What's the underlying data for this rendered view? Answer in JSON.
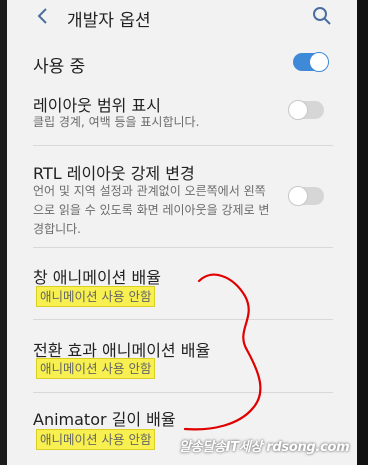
{
  "header": {
    "title": "개발자 옵션",
    "back_icon": "chevron-left-icon",
    "search_icon": "search-icon"
  },
  "main_toggle": {
    "label": "사용 중",
    "state": "on"
  },
  "items": [
    {
      "title": "레이아웃 범위 표시",
      "desc": "클립 경계, 여백 등을 표시합니다.",
      "toggle": "off"
    },
    {
      "title": "RTL 레이아웃 강제 변경",
      "desc": "언어 및 지역 설정과 관계없이 오른쪽에서 왼쪽으로 읽을 수 있도록 화면 레이아웃을 강제로 변경합니다.",
      "toggle": "off"
    },
    {
      "title": "창 애니메이션 배율",
      "value": "애니메이션 사용 안함"
    },
    {
      "title": "전환 효과 애니메이션 배율",
      "value": "애니메이션 사용 안함"
    },
    {
      "title": "Animator 길이 배율",
      "value": "애니메이션 사용 안함"
    }
  ],
  "watermark": "알송달송IT세상 rdsong.com",
  "colors": {
    "accent": "#3f8ad8",
    "highlight": "#f7f050",
    "annotation": "#e00000"
  }
}
